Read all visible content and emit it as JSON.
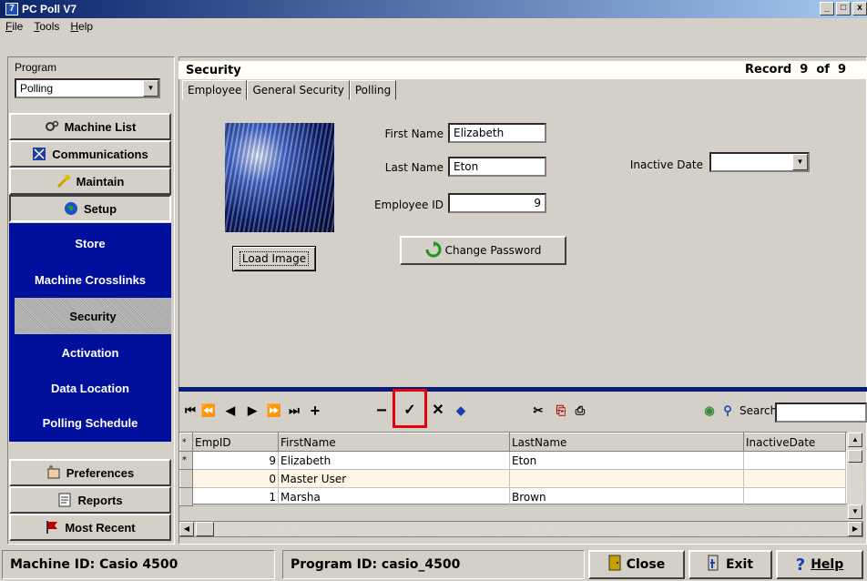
{
  "window": {
    "title": "PC Poll V7",
    "controls": [
      "_",
      "□",
      "x"
    ]
  },
  "menu": [
    {
      "prefix": "",
      "underline": "F",
      "rest": "ile"
    },
    {
      "prefix": "",
      "underline": "T",
      "rest": "ools"
    },
    {
      "prefix": "",
      "underline": "H",
      "rest": "elp"
    }
  ],
  "program": {
    "label": "Program",
    "value": "Polling"
  },
  "nav": {
    "machine_list": "Machine List",
    "communications": "Communications",
    "maintain": "Maintain",
    "setup": "Setup",
    "setup_items": [
      "Store",
      "Machine Crosslinks",
      "Security",
      "Activation",
      "Data Location",
      "Polling Schedule"
    ],
    "selected": "Security",
    "preferences": "Preferences",
    "reports": "Reports",
    "most_recent": "Most Recent"
  },
  "header": {
    "title": "Security",
    "record": "Record  9  of  9"
  },
  "tabs": [
    "Employee",
    "General Security",
    "Polling"
  ],
  "form": {
    "first_name_label": "First Name",
    "first_name": "Elizabeth",
    "last_name_label": "Last Name",
    "last_name": "Eton",
    "employee_id_label": "Employee ID",
    "employee_id": "9",
    "inactive_date_label": "Inactive Date",
    "inactive_date": "",
    "load_image": "Load Image",
    "change_password": "Change Password"
  },
  "toolbar": {
    "search_label": "Search",
    "search_value": ""
  },
  "grid": {
    "columns": [
      "EmpID",
      "FirstName",
      "LastName",
      "InactiveDate"
    ],
    "rows": [
      {
        "indicator": "*",
        "EmpID": "9",
        "FirstName": "Elizabeth",
        "LastName": "Eton",
        "InactiveDate": ""
      },
      {
        "indicator": "",
        "EmpID": "0",
        "FirstName": "Master User",
        "LastName": "",
        "InactiveDate": ""
      },
      {
        "indicator": "",
        "EmpID": "1",
        "FirstName": "Marsha",
        "LastName": "Brown",
        "InactiveDate": ""
      }
    ]
  },
  "status": {
    "machine_id": "Machine ID: Casio 4500",
    "program_id": "Program ID: casio_4500",
    "close": "Close",
    "exit": "Exit",
    "help": "Help"
  },
  "colors": {
    "nav_blue": "#000f9c",
    "highlight_red": "#e8000a",
    "title_gradient_start": "#0a246a"
  }
}
